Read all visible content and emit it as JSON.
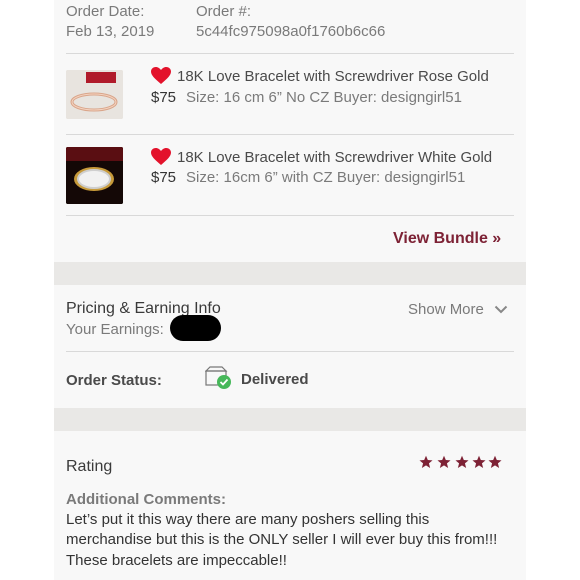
{
  "order": {
    "date_label": "Order Date:",
    "date_value": "Feb 13, 2019",
    "number_label": "Order #:",
    "number_value": "5c44fc975098a0f1760b6c66"
  },
  "items": [
    {
      "title": "18K Love Bracelet with Screwdriver Rose Gold",
      "price": "$75",
      "details": "Size: 16 cm 6” No CZ  Buyer: designgirl51"
    },
    {
      "title": "18K Love Bracelet with Screwdriver White Gold",
      "price": "$75",
      "details": "Size: 16cm 6” with CZ  Buyer: designgirl51"
    }
  ],
  "bundle": {
    "link_label": "View Bundle »"
  },
  "pricing": {
    "title": "Pricing & Earning Info",
    "earnings_label": "Your Earnings:",
    "show_more_label": "Show More"
  },
  "status": {
    "label": "Order Status:",
    "value": "Delivered"
  },
  "rating": {
    "title": "Rating",
    "stars": 5,
    "comments_label": "Additional Comments:",
    "comment_lines": [
      "Let’s put it this way there are many poshers selling this",
      "merchandise but this is the ONLY seller I will ever buy this from!!!",
      "These bracelets are impeccable!!"
    ]
  },
  "colors": {
    "accent": "#7d2235",
    "heart": "#e3122b",
    "check": "#46b85a"
  }
}
